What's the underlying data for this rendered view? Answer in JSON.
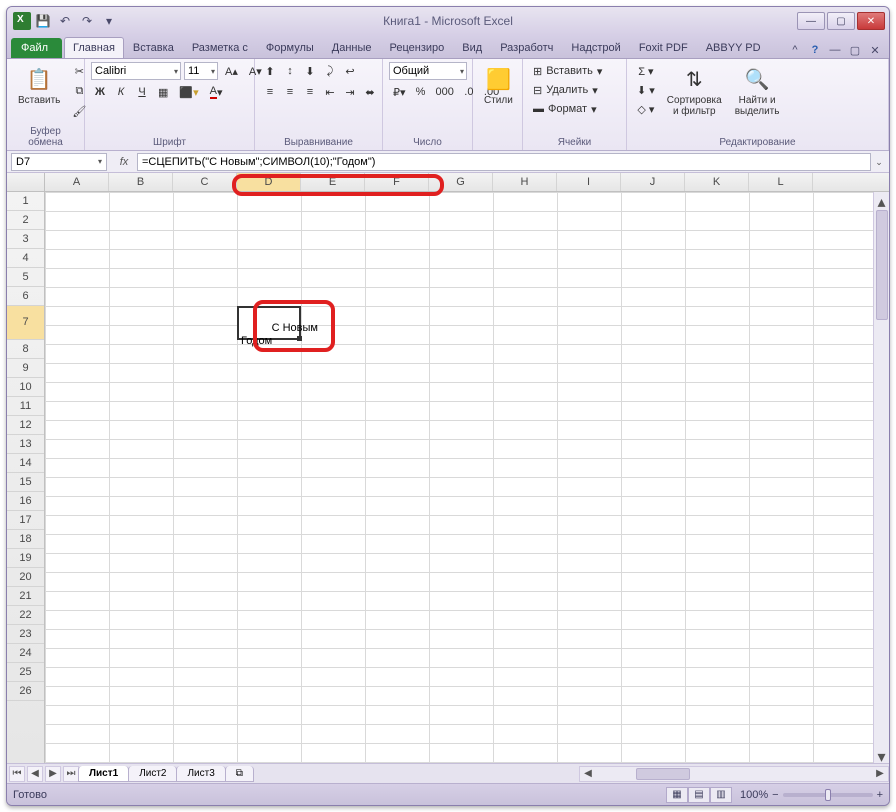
{
  "title": "Книга1 - Microsoft Excel",
  "qat": {
    "save": "💾",
    "undo": "↶",
    "redo": "↷",
    "more": "▾"
  },
  "tabs": {
    "file": "Файл",
    "items": [
      "Главная",
      "Вставка",
      "Разметка с",
      "Формулы",
      "Данные",
      "Рецензиро",
      "Вид",
      "Разработч",
      "Надстрой",
      "Foxit PDF",
      "ABBYY PD"
    ],
    "active_index": 0
  },
  "ribbon": {
    "clipboard": {
      "paste": "Вставить",
      "label": "Буфер обмена"
    },
    "font": {
      "name": "Calibri",
      "size": "11",
      "bold": "Ж",
      "italic": "К",
      "underline": "Ч",
      "label": "Шрифт"
    },
    "align": {
      "label": "Выравнивание"
    },
    "number": {
      "format": "Общий",
      "label": "Число"
    },
    "styles": {
      "btn": "Стили",
      "label": ""
    },
    "cells": {
      "insert": "Вставить",
      "delete": "Удалить",
      "format": "Формат",
      "label": "Ячейки"
    },
    "editing": {
      "sort": "Сортировка\nи фильтр",
      "find": "Найти и\nвыделить",
      "label": "Редактирование"
    }
  },
  "namebox": "D7",
  "formula": "=СЦЕПИТЬ(\"С Новым\";СИМВОЛ(10);\"Годом\")",
  "columns": [
    "A",
    "B",
    "C",
    "D",
    "E",
    "F",
    "G",
    "H",
    "I",
    "J",
    "K",
    "L"
  ],
  "rows_before": [
    1,
    2,
    3,
    4,
    5,
    6
  ],
  "row_sel": 7,
  "rows_after": [
    8,
    9,
    10,
    11,
    12,
    13,
    14,
    15,
    16,
    17,
    18,
    19,
    20,
    21,
    22,
    23,
    24,
    25,
    26
  ],
  "cell_value": "С Новым\nГодом",
  "sheets": {
    "items": [
      "Лист1",
      "Лист2",
      "Лист3"
    ],
    "active_index": 0
  },
  "status": "Готово",
  "zoom": "100%"
}
